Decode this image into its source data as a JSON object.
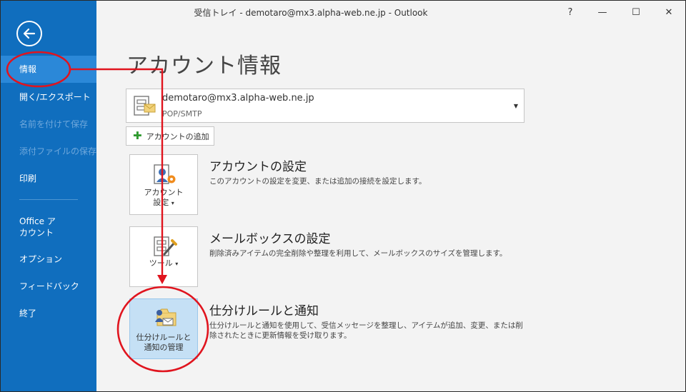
{
  "window": {
    "title": "受信トレイ - demotaro@mx3.alpha-web.ne.jp - Outlook",
    "help_label": "?",
    "minimize_label": "—",
    "maximize_label": "☐",
    "close_label": "✕"
  },
  "sidebar": {
    "items": [
      {
        "label": "情報",
        "state": "active"
      },
      {
        "label": "開く/エクスポート",
        "state": "normal"
      },
      {
        "label": "名前を付けて保存",
        "state": "disabled"
      },
      {
        "label": "添付ファイルの保存",
        "state": "disabled"
      },
      {
        "label": "印刷",
        "state": "normal"
      },
      {
        "label": "Office ア",
        "label2": "カウント",
        "state": "normal"
      },
      {
        "label": "オプション",
        "state": "normal"
      },
      {
        "label": "フィードバック",
        "state": "normal"
      },
      {
        "label": "終了",
        "state": "normal"
      }
    ]
  },
  "main": {
    "title": "アカウント情報",
    "account": {
      "email": "demotaro@mx3.alpha-web.ne.jp",
      "type": "POP/SMTP"
    },
    "add_account_label": "アカウントの追加",
    "sections": [
      {
        "tile_label_1": "アカウント",
        "tile_label_2": "設定",
        "tile_caret": "▾",
        "title": "アカウントの設定",
        "desc": "このアカウントの設定を変更、または追加の接続を設定します。"
      },
      {
        "tile_label_1": "ツール",
        "tile_caret": "▾",
        "title": "メールボックスの設定",
        "desc": "削除済みアイテムの完全削除や整理を利用して、メールボックスのサイズを管理します。"
      },
      {
        "tile_label_1": "仕分けルールと",
        "tile_label_2": "通知の管理",
        "title": "仕分けルールと通知",
        "desc": "仕分けルールと通知を使用して、受信メッセージを整理し、アイテムが追加、変更、または削除されたときに更新情報を受け取ります。"
      }
    ]
  },
  "colors": {
    "sidebar": "#106ebe",
    "sidebar_active": "#2b88d8",
    "annotation": "#e0141e"
  }
}
